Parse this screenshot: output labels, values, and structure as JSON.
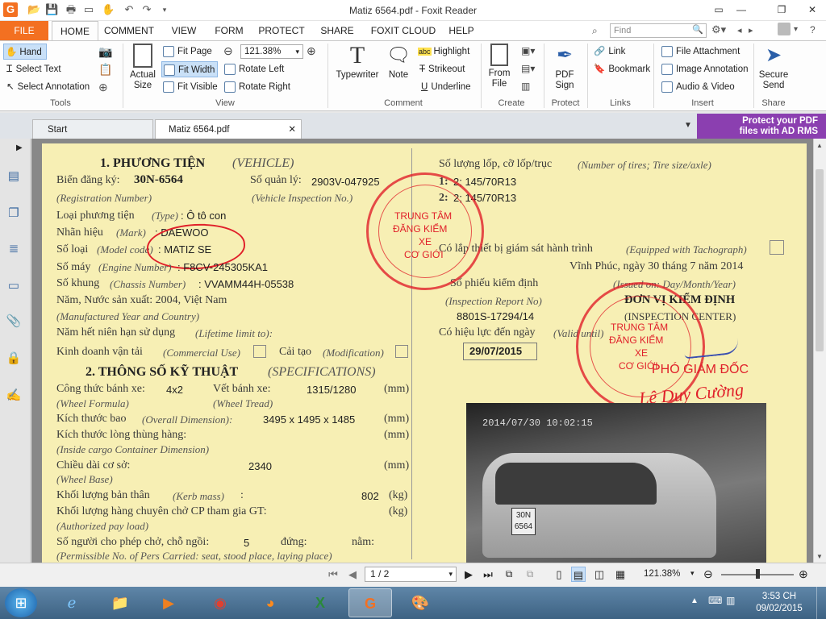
{
  "window": {
    "title": "Matiz 6564.pdf - Foxit Reader",
    "app_icon": "G"
  },
  "menu": {
    "tabs": [
      "FILE",
      "HOME",
      "COMMENT",
      "VIEW",
      "FORM",
      "PROTECT",
      "SHARE",
      "FOXIT CLOUD",
      "HELP"
    ],
    "find_placeholder": "Find"
  },
  "ribbon": {
    "tools": {
      "hand": "Hand",
      "select_text": "Select Text",
      "select_annotation": "Select Annotation",
      "label": "Tools"
    },
    "view": {
      "actual_size": "Actual\nSize",
      "fit_page": "Fit Page",
      "fit_width": "Fit Width",
      "fit_visible": "Fit Visible",
      "zoom": "121.38%",
      "rotate_left": "Rotate Left",
      "rotate_right": "Rotate Right",
      "label": "View"
    },
    "comment": {
      "typewriter": "Typewriter",
      "note": "Note",
      "highlight": "Highlight",
      "strikeout": "Strikeout",
      "underline": "Underline",
      "label": "Comment"
    },
    "create": {
      "from_file": "From\nFile",
      "label": "Create"
    },
    "protect": {
      "pdf_sign": "PDF\nSign",
      "label": "Protect"
    },
    "links": {
      "link": "Link",
      "bookmark": "Bookmark",
      "label": "Links"
    },
    "insert": {
      "file_attachment": "File Attachment",
      "image_annotation": "Image Annotation",
      "audio_video": "Audio & Video",
      "label": "Insert"
    },
    "share": {
      "secure_send": "Secure\nSend",
      "label": "Share"
    }
  },
  "doc_tabs": {
    "start": "Start",
    "current": "Matiz 6564.pdf"
  },
  "ad": {
    "line1": "Protect your PDF",
    "line2": "files with AD RMS"
  },
  "document": {
    "s1_title": "1. PHƯƠNG TIỆN",
    "s1_title_en": "(VEHICLE)",
    "reg_label": "Biển đăng ký:",
    "reg_value": "30N-6564",
    "reg_en": "(Registration Number)",
    "mgmt_label": "Số quản lý:",
    "mgmt_value": "2903V-047925",
    "mgmt_en": "(Vehicle Inspection No.)",
    "type_label": "Loại phương tiện",
    "type_en": "(Type)",
    "type_value": ": Ô tô con",
    "mark_label": "Nhãn hiệu",
    "mark_en": "(Mark)",
    "mark_value": ": DAEWOO",
    "model_label": "Số loại",
    "model_en": "(Model code)",
    "model_value": ": MATIZ SE",
    "engine_label": "Số máy",
    "engine_en": "(Engine Number)",
    "engine_value": ": F8CV-245305KA1",
    "chassis_label": "Số khung",
    "chassis_en": "(Chassis Number)",
    "chassis_value": ": VVAMM44H-05538",
    "year_label": "Năm, Nước sản xuất: 2004, Việt Nam",
    "year_en": "(Manufactured Year and Country)",
    "lifetime_label": "Năm hết niên hạn sử dụng",
    "lifetime_en": "(Lifetime limit to):",
    "commercial_label": "Kinh doanh vận tải",
    "commercial_en": "(Commercial Use)",
    "modification_label": "Cải tạo",
    "modification_en": "(Modification)",
    "s2_title": "2. THÔNG SỐ KỸ THUẬT",
    "s2_title_en": "(SPECIFICATIONS)",
    "wheel_formula_label": "Công thức bánh xe:",
    "wheel_formula_value": "4x2",
    "wheel_formula_en": "(Wheel Formula)",
    "wheel_tread_label": "Vết bánh xe:",
    "wheel_tread_en": "(Wheel Tread)",
    "wheel_tread_value": "1315/1280",
    "wheel_tread_unit": "(mm)",
    "overall_label": "Kích thước bao",
    "overall_en": "(Overall Dimension):",
    "overall_value": "3495 x 1495 x 1485",
    "overall_unit": "(mm)",
    "cargo_label": "Kích thước lòng thùng hàng:",
    "cargo_en": "(Inside cargo Container Dimension)",
    "cargo_unit": "(mm)",
    "wheelbase_label": "Chiều dài cơ sở:",
    "wheelbase_value": "2340",
    "wheelbase_unit": "(mm)",
    "wheelbase_en": "(Wheel Base)",
    "kerb_label": "Khối lượng bản thân",
    "kerb_en": "(Kerb mass)",
    "kerb_colon": ":",
    "kerb_value": "802",
    "kerb_unit": "(kg)",
    "payload_label": "Khối lượng hàng chuyên chở CP tham gia GT:",
    "payload_unit": "(kg)",
    "payload_en": "(Authorized pay load)",
    "persons_label": "Số người cho phép chở, chỗ ngồi:",
    "persons_value": "5",
    "standing_label": "đứng:",
    "lying_label": "nằm:",
    "persons_en": "(Permissible No. of Pers Carried: seat, stood place, laying place)",
    "tires_label": "Số lượng lốp, cỡ lốp/trục",
    "tires_en": "(Number of tires; Tire size/axle)",
    "axle1": "1:",
    "axle1_value": "2; 145/70R13",
    "axle2": "2:",
    "axle2_value": "2; 145/70R13",
    "tacho_label": "Có lắp thiết bị giám sát hành trình",
    "tacho_en": "(Equipped with Tachograph)",
    "place_date": "Vĩnh Phúc, ngày 30 tháng 7 năm  2014",
    "report_label": "Số phiếu kiểm định",
    "report_en": "(Inspection Report No)",
    "report_value": "8801S-17294/14",
    "issued_en": "(Issued on: Day/Month/Year)",
    "center_label": "ĐƠN VỊ KIỂM ĐỊNH",
    "center_en": "(INSPECTION CENTER)",
    "valid_label": "Có hiệu lực đến ngày",
    "valid_en": "(Valid until)",
    "valid_value": "29/07/2015",
    "stamp_text1": "TRUNG TÂM",
    "stamp_text2": "ĐĂNG KIỂM",
    "stamp_text3": "XE",
    "stamp_text4": "CƠ GIỚI",
    "deputy": "PHÓ GIÁM ĐỐC",
    "signature_name": "Lê Duy Cường",
    "photo_timestamp": "2014/07/30 10:02:15",
    "photo_plate": "30N 6564"
  },
  "status": {
    "page": "1 / 2",
    "zoom": "121.38%"
  },
  "taskbar": {
    "time": "3:53 CH",
    "date": "09/02/2015"
  },
  "colors": {
    "accent": "#f37021",
    "paper": "#f7efb4",
    "stamp": "#e0202a",
    "ad": "#8b3fb0"
  }
}
